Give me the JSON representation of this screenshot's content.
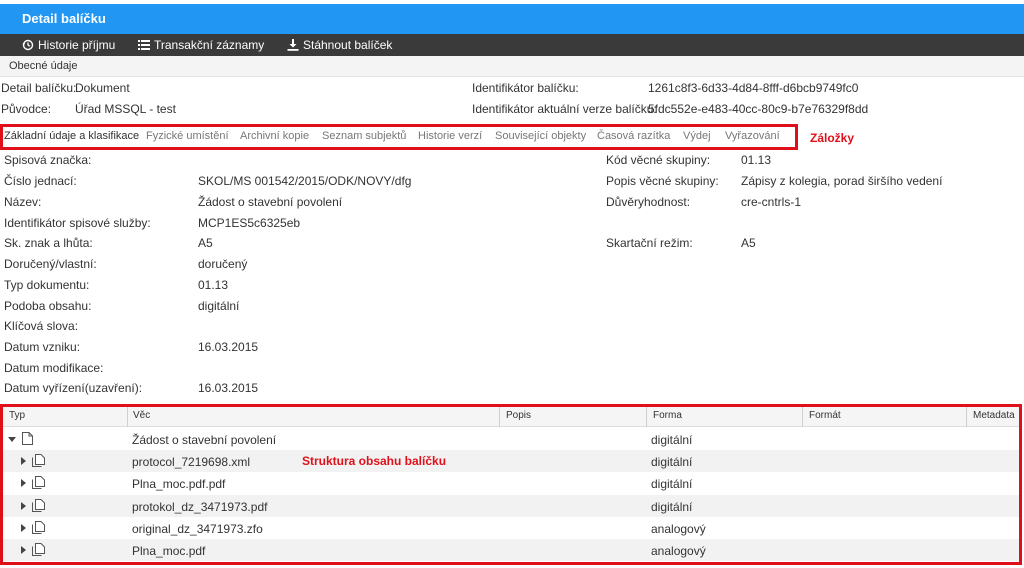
{
  "window": {
    "title": "Detail balíčku"
  },
  "toolbar": {
    "history_label": "Historie příjmu",
    "transactions_label": "Transakční záznamy",
    "download_label": "Stáhnout balíček"
  },
  "general_tab": {
    "label": "Obecné údaje"
  },
  "header": {
    "detail_label": "Detail balíčku:",
    "detail_value": "Dokument",
    "originator_label": "Původce:",
    "originator_value": "Úřad MSSQL - test",
    "package_id_label": "Identifikátor balíčku:",
    "package_id_value": "1261c8f3-6d33-4d84-8fff-d6bcb9749fc0",
    "version_id_label": "Identifikátor aktuální verze balíčku:",
    "version_id_value": "5fdc552e-e483-40cc-80c9-b7e76329f8dd"
  },
  "tabs": [
    {
      "label": "Základní údaje a klasifikace",
      "active": true
    },
    {
      "label": "Fyzické umístění"
    },
    {
      "label": "Archivní kopie"
    },
    {
      "label": "Seznam subjektů"
    },
    {
      "label": "Historie verzí"
    },
    {
      "label": "Související objekty"
    },
    {
      "label": "Časová razítka"
    },
    {
      "label": "Výdej"
    },
    {
      "label": "Vyřazování"
    }
  ],
  "annotations": {
    "tabs": "Záložky",
    "structure": "Struktura obsahu balíčku"
  },
  "fields_left": [
    {
      "label": "Spisová značka:",
      "value": ""
    },
    {
      "label": "Číslo jednací:",
      "value": "SKOL/MS 001542/2015/ODK/NOVY/dfg"
    },
    {
      "label": "Název:",
      "value": "Žádost o stavební povolení"
    },
    {
      "label": "Identifikátor spisové služby:",
      "value": "MCP1ES5c6325eb"
    },
    {
      "label": "Sk. znak a lhůta:",
      "value": "A5"
    },
    {
      "label": "Doručený/vlastní:",
      "value": "doručený"
    },
    {
      "label": "Typ dokumentu:",
      "value": "01.13"
    },
    {
      "label": "Podoba obsahu:",
      "value": "digitální"
    },
    {
      "label": "Klíčová slova:",
      "value": ""
    },
    {
      "label": "Datum vzniku:",
      "value": "16.03.2015"
    },
    {
      "label": "Datum modifikace:",
      "value": ""
    },
    {
      "label": "Datum vyřízení(uzavření):",
      "value": "16.03.2015"
    }
  ],
  "fields_right": [
    {
      "label": "Kód věcné skupiny:",
      "value": "01.13"
    },
    {
      "label": "Popis věcné skupiny:",
      "value": "Zápisy z kolegia, porad širšího vedení"
    },
    {
      "label": "Důvěryhodnost:",
      "value": "cre-cntrls-1"
    },
    {
      "label": "Skartační režim:",
      "value": "A5"
    }
  ],
  "tree": {
    "columns": [
      "Typ",
      "Věc",
      "Popis",
      "Forma",
      "Formát",
      "Metadata"
    ],
    "rows": [
      {
        "icon": "document-icon",
        "expanded": true,
        "name": "Žádost o stavební povolení",
        "form": "digitální"
      },
      {
        "icon": "documents-icon",
        "expanded": false,
        "name": "protocol_7219698.xml",
        "form": "digitální"
      },
      {
        "icon": "documents-icon",
        "expanded": false,
        "name": "Plna_moc.pdf.pdf",
        "form": "digitální"
      },
      {
        "icon": "documents-icon",
        "expanded": false,
        "name": "protokol_dz_3471973.pdf",
        "form": "digitální"
      },
      {
        "icon": "documents-icon",
        "expanded": false,
        "name": "original_dz_3471973.zfo",
        "form": "analogový"
      },
      {
        "icon": "documents-icon",
        "expanded": false,
        "name": "Plna_moc.pdf",
        "form": "analogový"
      }
    ]
  },
  "colors": {
    "titlebar": "#2196f3",
    "toolbar": "#3a3a3a",
    "highlight": "#e0101a"
  }
}
